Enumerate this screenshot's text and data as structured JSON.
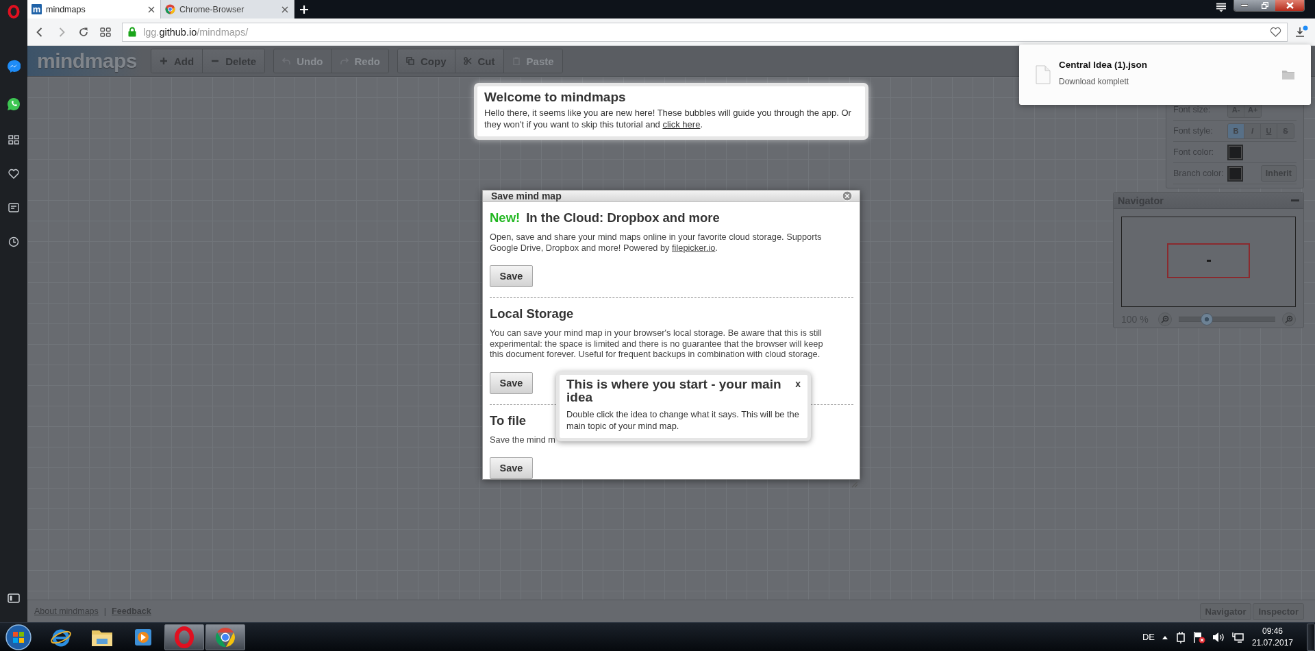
{
  "browser": {
    "tabs": [
      {
        "kind": "letter",
        "icon_text": "m",
        "title": "mindmaps",
        "selected": true
      },
      {
        "kind": "circle",
        "title": "Chrome-Browser",
        "selected": false
      }
    ],
    "address": {
      "prefix": "lgg.",
      "host": "github.io",
      "path": "/mindmaps/"
    }
  },
  "app": {
    "logo": "mindmaps",
    "toolbar": [
      {
        "buttons": [
          {
            "label": "Add",
            "disabled": false
          },
          {
            "label": "Delete",
            "disabled": false
          }
        ]
      },
      {
        "buttons": [
          {
            "label": "Undo",
            "disabled": true
          },
          {
            "label": "Redo",
            "disabled": true
          }
        ]
      },
      {
        "buttons": [
          {
            "label": "Copy",
            "disabled": false
          },
          {
            "label": "Cut",
            "disabled": false
          },
          {
            "label": "Paste",
            "disabled": true
          }
        ]
      }
    ],
    "footer": {
      "links": [
        "About mindmaps",
        "Feedback"
      ],
      "separator": "|",
      "panel_buttons": [
        "Navigator",
        "Inspector"
      ]
    }
  },
  "download": {
    "file": "Central Idea (1).json",
    "status": "Download komplett"
  },
  "inspector": {
    "rows": [
      {
        "kind": "buttons",
        "label": "Font size:",
        "buttons": [
          {
            "label": "A-"
          },
          {
            "label": "A+"
          }
        ]
      },
      {
        "kind": "buttons",
        "label": "Font style:",
        "buttons": [
          {
            "label": "B",
            "selected": true
          },
          {
            "label": "I",
            "selected": false
          },
          {
            "label": "U",
            "selected": false
          },
          {
            "label": "S",
            "selected": false
          }
        ]
      },
      {
        "kind": "color",
        "label": "Font color:"
      },
      {
        "kind": "color",
        "label": "Branch color:",
        "button": "Inherit"
      }
    ]
  },
  "navigator": {
    "title": "Navigator",
    "zoom": "100 %",
    "level": 0.26
  },
  "welcome": {
    "title": "Welcome to mindmaps",
    "text": "Hello there, it seems like you are new here! These bubbles will guide you through the app. Or they won't if you want to skip this tutorial and ",
    "link": "click here",
    "text_after": "."
  },
  "dialog": {
    "title": "Save mind map",
    "sections": [
      {
        "badge": "New!",
        "title": "In the Cloud: Dropbox and more",
        "text": "Open, save and share your mind maps online in your favorite cloud storage. Supports Google Drive, Dropbox and more! Powered by ",
        "link": "filepicker.io",
        "text_after": ".",
        "button": "Save"
      },
      {
        "title": "Local Storage",
        "text": "You can save your mind map in your browser's local storage. Be aware that this is still experimental: the space is limited and there is no guarantee that the browser will keep this document forever. Useful for frequent backups in combination with cloud storage.",
        "button": "Save"
      },
      {
        "title": "To file",
        "text": "Save the mind m",
        "button": "Save"
      }
    ]
  },
  "tutorial": {
    "title": "This is where you start - your main idea",
    "close": "x",
    "text": "Double click the idea to change what it says. This will be the main topic of your mind map."
  },
  "taskbar": {
    "apps": [
      {
        "kind": "ie",
        "open": false
      },
      {
        "kind": "explorer",
        "open": false
      },
      {
        "kind": "media",
        "open": false
      },
      {
        "kind": "opera",
        "open": true
      },
      {
        "kind": "chrome",
        "open": true
      }
    ],
    "language": "DE",
    "time": "09:46",
    "date": "21.07.2017"
  }
}
